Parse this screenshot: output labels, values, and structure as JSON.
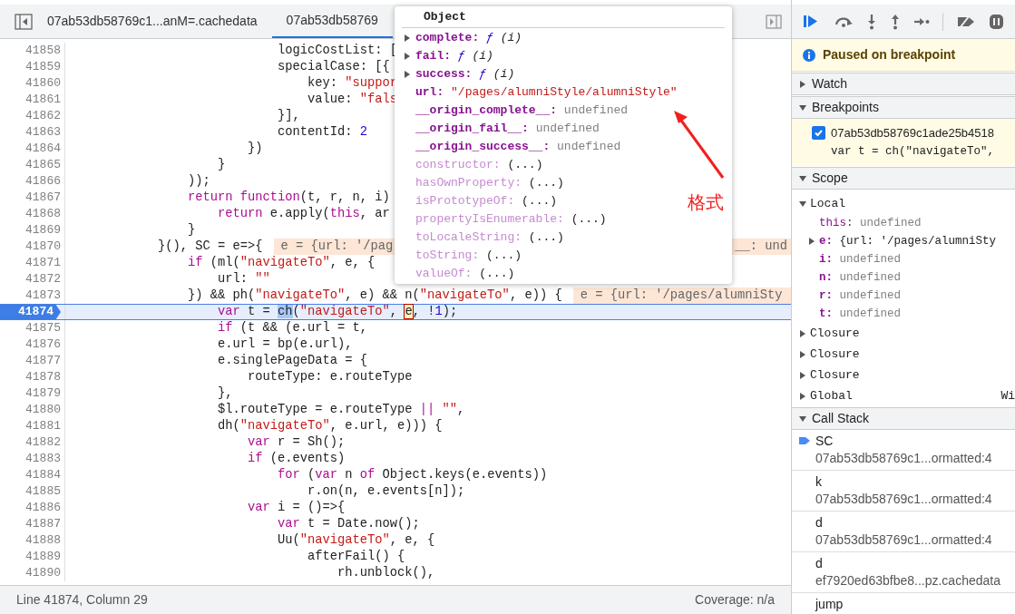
{
  "editor": {
    "tabs": [
      {
        "label": "07ab53db58769c1...anM=.cachedata",
        "selected": false
      },
      {
        "label": "07ab53db58769",
        "selected": true
      }
    ],
    "lines": [
      {
        "number": "41858",
        "current": false,
        "tokens": [
          {
            "kind": "plain",
            "text": "                            logicCostList: ["
          }
        ]
      },
      {
        "number": "41859",
        "current": false,
        "tokens": [
          {
            "kind": "plain",
            "text": "                            specialCase: [{"
          }
        ]
      },
      {
        "number": "41860",
        "current": false,
        "tokens": [
          {
            "kind": "plain",
            "text": "                                key: "
          },
          {
            "kind": "string",
            "text": "\"suppor"
          }
        ]
      },
      {
        "number": "41861",
        "current": false,
        "tokens": [
          {
            "kind": "plain",
            "text": "                                value: "
          },
          {
            "kind": "string",
            "text": "\"fals"
          }
        ]
      },
      {
        "number": "41862",
        "current": false,
        "tokens": [
          {
            "kind": "plain",
            "text": "                            }],"
          }
        ]
      },
      {
        "number": "41863",
        "current": false,
        "tokens": [
          {
            "kind": "plain",
            "text": "                            contentId: "
          },
          {
            "kind": "number",
            "text": "2"
          }
        ]
      },
      {
        "number": "41864",
        "current": false,
        "tokens": [
          {
            "kind": "plain",
            "text": "                        })"
          }
        ]
      },
      {
        "number": "41865",
        "current": false,
        "tokens": [
          {
            "kind": "plain",
            "text": "                    }"
          }
        ]
      },
      {
        "number": "41866",
        "current": false,
        "tokens": [
          {
            "kind": "plain",
            "text": "                ));"
          }
        ]
      },
      {
        "number": "41867",
        "current": false,
        "tokens": [
          {
            "kind": "keyword",
            "text": "                return"
          },
          {
            "kind": "keyword",
            "text": " function"
          },
          {
            "kind": "plain",
            "text": "(t, r, n, i)"
          }
        ]
      },
      {
        "number": "41868",
        "current": false,
        "tokens": [
          {
            "kind": "keyword",
            "text": "                    return"
          },
          {
            "kind": "plain",
            "text": " e.apply("
          },
          {
            "kind": "keyword",
            "text": "this"
          },
          {
            "kind": "plain",
            "text": ", ar"
          }
        ]
      },
      {
        "number": "41869",
        "current": false,
        "tokens": [
          {
            "kind": "plain",
            "text": "                }"
          }
        ]
      },
      {
        "number": "41870",
        "current": false,
        "tokens": [
          {
            "kind": "plain",
            "text": "            }(), SC = e=>{"
          }
        ],
        "inline_value": {
          "text": "e = {url: '/pag",
          "tail": "__: und"
        }
      },
      {
        "number": "41871",
        "current": false,
        "tokens": [
          {
            "kind": "keyword",
            "text": "                if"
          },
          {
            "kind": "plain",
            "text": " (ml("
          },
          {
            "kind": "string",
            "text": "\"navigateTo\""
          },
          {
            "kind": "plain",
            "text": ", e, {"
          }
        ]
      },
      {
        "number": "41872",
        "current": false,
        "tokens": [
          {
            "kind": "plain",
            "text": "                    url: "
          },
          {
            "kind": "string",
            "text": "\"\""
          }
        ]
      },
      {
        "number": "41873",
        "current": false,
        "tokens": [
          {
            "kind": "plain",
            "text": "                }) && ph("
          },
          {
            "kind": "string",
            "text": "\"navigateTo\""
          },
          {
            "kind": "plain",
            "text": ", e) && n("
          },
          {
            "kind": "string",
            "text": "\"navigateTo\""
          },
          {
            "kind": "plain",
            "text": ", e)) {"
          }
        ],
        "inline_value": {
          "text": "e = {url: '/pages/alumniSty"
        }
      },
      {
        "number": "41874",
        "current": true,
        "tokens": [
          {
            "kind": "keyword",
            "text": "                    var"
          },
          {
            "kind": "plain",
            "text": " t = "
          },
          {
            "kind": "selection",
            "text": "ch"
          },
          {
            "kind": "plain",
            "text": "("
          },
          {
            "kind": "string",
            "text": "\"navigateTo\""
          },
          {
            "kind": "plain",
            "text": ", "
          },
          {
            "kind": "cursor",
            "text": "e"
          },
          {
            "kind": "plain",
            "text": ", !"
          },
          {
            "kind": "number",
            "text": "1"
          },
          {
            "kind": "plain",
            "text": ");"
          }
        ]
      },
      {
        "number": "41875",
        "current": false,
        "tokens": [
          {
            "kind": "keyword",
            "text": "                    if"
          },
          {
            "kind": "plain",
            "text": " (t && (e.url = t,"
          }
        ]
      },
      {
        "number": "41876",
        "current": false,
        "tokens": [
          {
            "kind": "plain",
            "text": "                    e.url = bp(e.url),"
          }
        ]
      },
      {
        "number": "41877",
        "current": false,
        "tokens": [
          {
            "kind": "plain",
            "text": "                    e.singlePageData = {"
          }
        ]
      },
      {
        "number": "41878",
        "current": false,
        "tokens": [
          {
            "kind": "plain",
            "text": "                        routeType: e.routeType"
          }
        ]
      },
      {
        "number": "41879",
        "current": false,
        "tokens": [
          {
            "kind": "plain",
            "text": "                    },"
          }
        ]
      },
      {
        "number": "41880",
        "current": false,
        "tokens": [
          {
            "kind": "plain",
            "text": "                    $l.routeType = e.routeType "
          },
          {
            "kind": "keyword",
            "text": "||"
          },
          {
            "kind": "string",
            "text": " \"\""
          },
          {
            "kind": "plain",
            "text": ","
          }
        ]
      },
      {
        "number": "41881",
        "current": false,
        "tokens": [
          {
            "kind": "plain",
            "text": "                    dh("
          },
          {
            "kind": "string",
            "text": "\"navigateTo\""
          },
          {
            "kind": "plain",
            "text": ", e.url, e))) {"
          }
        ]
      },
      {
        "number": "41882",
        "current": false,
        "tokens": [
          {
            "kind": "keyword",
            "text": "                        var"
          },
          {
            "kind": "plain",
            "text": " r = Sh();"
          }
        ]
      },
      {
        "number": "41883",
        "current": false,
        "tokens": [
          {
            "kind": "keyword",
            "text": "                        if"
          },
          {
            "kind": "plain",
            "text": " (e.events)"
          }
        ]
      },
      {
        "number": "41884",
        "current": false,
        "tokens": [
          {
            "kind": "keyword",
            "text": "                            for"
          },
          {
            "kind": "plain",
            "text": " ("
          },
          {
            "kind": "keyword",
            "text": "var"
          },
          {
            "kind": "plain",
            "text": " n "
          },
          {
            "kind": "keyword",
            "text": "of"
          },
          {
            "kind": "plain",
            "text": " Object.keys(e.events))"
          }
        ]
      },
      {
        "number": "41885",
        "current": false,
        "tokens": [
          {
            "kind": "plain",
            "text": "                                r.on(n, e.events[n]);"
          }
        ]
      },
      {
        "number": "41886",
        "current": false,
        "tokens": [
          {
            "kind": "keyword",
            "text": "                        var"
          },
          {
            "kind": "plain",
            "text": " i = ()=>{"
          }
        ]
      },
      {
        "number": "41887",
        "current": false,
        "tokens": [
          {
            "kind": "keyword",
            "text": "                            var"
          },
          {
            "kind": "plain",
            "text": " t = Date.now();"
          }
        ]
      },
      {
        "number": "41888",
        "current": false,
        "tokens": [
          {
            "kind": "plain",
            "text": "                            Uu("
          },
          {
            "kind": "string",
            "text": "\"navigateTo\""
          },
          {
            "kind": "plain",
            "text": ", e, {"
          }
        ]
      },
      {
        "number": "41889",
        "current": false,
        "tokens": [
          {
            "kind": "plain",
            "text": "                                afterFail() {"
          }
        ]
      },
      {
        "number": "41890",
        "current": false,
        "tokens": [
          {
            "kind": "plain",
            "text": "                                    rh.unblock(),"
          }
        ]
      }
    ],
    "status_bar": {
      "position": "Line 41874, Column 29",
      "coverage": "Coverage: n/a"
    }
  },
  "popover": {
    "title": "Object",
    "properties": [
      {
        "name": "complete:",
        "kind": "function",
        "expandable": true,
        "prefix": "ƒ",
        "value": "(i)"
      },
      {
        "name": "fail:",
        "kind": "function",
        "expandable": true,
        "prefix": "ƒ",
        "value": "(i)"
      },
      {
        "name": "success:",
        "kind": "function",
        "expandable": true,
        "prefix": "ƒ",
        "value": "(i)"
      },
      {
        "name": "url:",
        "kind": "string",
        "expandable": false,
        "value": "\"/pages/alumniStyle/alumniStyle\""
      },
      {
        "name": "__origin_complete__:",
        "kind": "undefined",
        "expandable": false,
        "value": "undefined"
      },
      {
        "name": "__origin_fail__:",
        "kind": "undefined",
        "expandable": false,
        "value": "undefined"
      },
      {
        "name": "__origin_success__:",
        "kind": "undefined",
        "expandable": false,
        "value": "undefined"
      },
      {
        "name": "constructor:",
        "kind": "inherited",
        "expandable": false,
        "value": "(...)"
      },
      {
        "name": "hasOwnProperty:",
        "kind": "inherited",
        "expandable": false,
        "value": "(...)"
      },
      {
        "name": "isPrototypeOf:",
        "kind": "inherited",
        "expandable": false,
        "value": "(...)"
      },
      {
        "name": "propertyIsEnumerable:",
        "kind": "inherited",
        "expandable": false,
        "value": "(...)"
      },
      {
        "name": "toLocaleString:",
        "kind": "inherited",
        "expandable": false,
        "value": "(...)"
      },
      {
        "name": "toString:",
        "kind": "inherited",
        "expandable": false,
        "value": "(...)"
      },
      {
        "name": "valueOf:",
        "kind": "inherited",
        "expandable": false,
        "value": "(...)"
      }
    ],
    "annotation": {
      "text": "格式"
    }
  },
  "debugger": {
    "paused_message": "Paused on breakpoint",
    "sections": [
      {
        "kind": "watch",
        "title": "Watch",
        "expanded": false
      },
      {
        "kind": "breakpoints",
        "title": "Breakpoints",
        "expanded": true,
        "items": [
          {
            "file": "07ab53db58769c1ade25b4518",
            "code": "var t = ch(\"navigateTo\",",
            "checked": true
          }
        ]
      },
      {
        "kind": "scope",
        "title": "Scope",
        "expanded": true,
        "groups": [
          {
            "name": "Local",
            "expanded": true,
            "vars": [
              {
                "name": "this:",
                "kind": "undefined",
                "own": false,
                "expandable": false,
                "value": "undefined"
              },
              {
                "name": "e:",
                "kind": "object",
                "own": true,
                "expandable": true,
                "value": "{url: '/pages/alumniSty"
              },
              {
                "name": "i:",
                "kind": "undefined",
                "own": true,
                "expandable": false,
                "value": "undefined"
              },
              {
                "name": "n:",
                "kind": "undefined",
                "own": true,
                "expandable": false,
                "value": "undefined"
              },
              {
                "name": "r:",
                "kind": "undefined",
                "own": true,
                "expandable": false,
                "value": "undefined"
              },
              {
                "name": "t:",
                "kind": "undefined",
                "own": true,
                "expandable": false,
                "value": "undefined"
              }
            ]
          },
          {
            "name": "Closure",
            "expanded": false
          },
          {
            "name": "Closure",
            "expanded": false
          },
          {
            "name": "Closure",
            "expanded": false
          },
          {
            "name": "Global",
            "expanded": false,
            "value": "Wi"
          }
        ]
      },
      {
        "kind": "callstack",
        "title": "Call Stack",
        "expanded": true,
        "frames": [
          {
            "name": "SC",
            "location": "07ab53db58769c1...ormatted:4",
            "current": true
          },
          {
            "name": "k",
            "location": "07ab53db58769c1...ormatted:4",
            "current": false
          },
          {
            "name": "d",
            "location": "07ab53db58769c1...ormatted:4",
            "current": false
          },
          {
            "name": "d",
            "location": "ef7920ed63bfbe8...pz.cachedata",
            "current": false
          },
          {
            "name": "jump",
            "current": false
          }
        ]
      }
    ]
  }
}
